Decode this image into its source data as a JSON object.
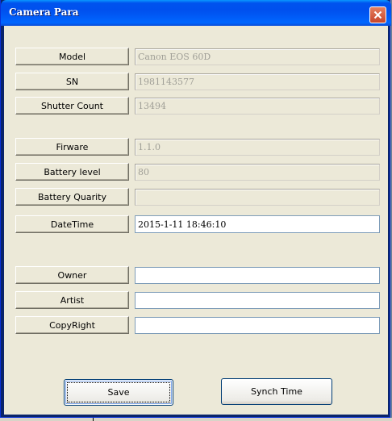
{
  "window": {
    "title": "Camera Para"
  },
  "fields": [
    {
      "label": "Model",
      "value": "Canon EOS 60D",
      "readonly": true
    },
    {
      "label": "SN",
      "value": "1981143577",
      "readonly": true
    },
    {
      "label": "Shutter Count",
      "value": "13494",
      "readonly": true
    },
    {
      "label": "Firware",
      "value": "1.1.0",
      "readonly": true
    },
    {
      "label": "Battery level",
      "value": "80",
      "readonly": true
    },
    {
      "label": "Battery Quarity",
      "value": "",
      "readonly": true
    },
    {
      "label": "DateTime",
      "value": "2015-1-11 18:46:10",
      "readonly": false
    },
    {
      "label": "Owner",
      "value": "",
      "readonly": false
    },
    {
      "label": "Artist",
      "value": "",
      "readonly": false
    },
    {
      "label": "CopyRight",
      "value": "",
      "readonly": false
    }
  ],
  "buttons": {
    "save": "Save",
    "synch": "Synch Time"
  },
  "icons": {
    "close": "close-icon"
  }
}
